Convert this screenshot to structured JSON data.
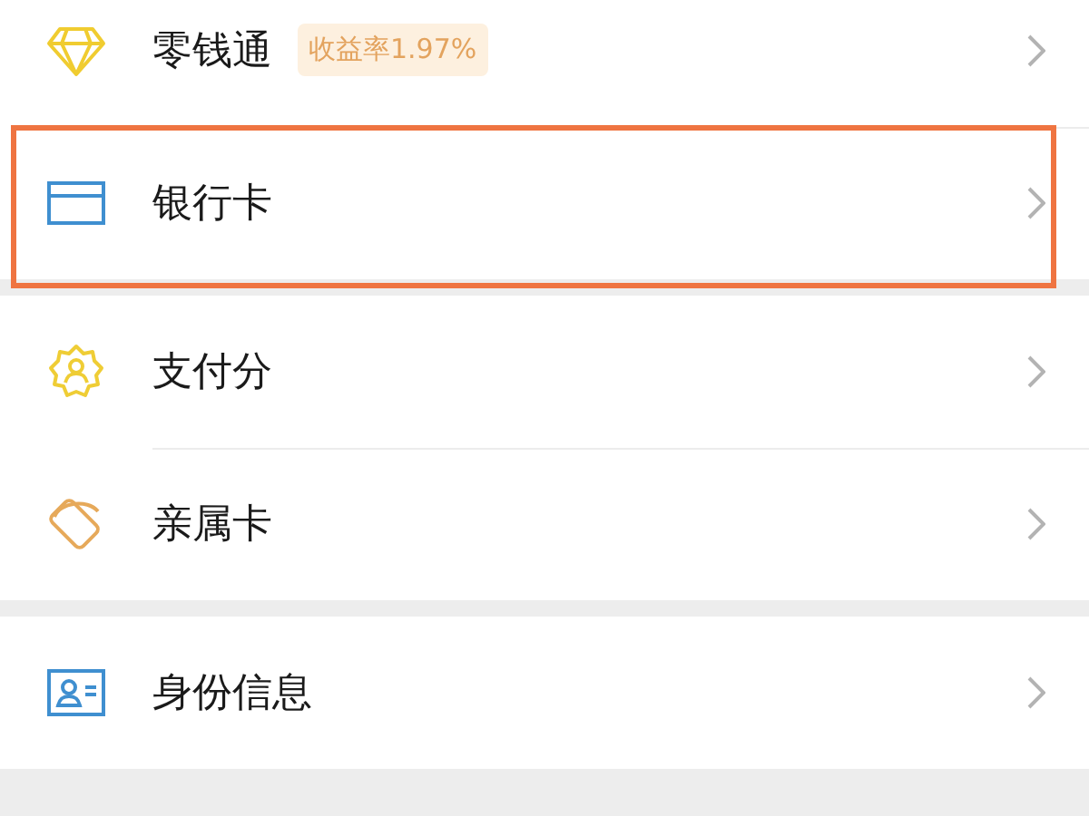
{
  "sections": [
    {
      "items": [
        {
          "label": "零钱通",
          "badge": "收益率1.97%",
          "highlighted": false
        },
        {
          "label": "银行卡",
          "highlighted": true
        }
      ]
    },
    {
      "items": [
        {
          "label": "支付分",
          "highlighted": false
        },
        {
          "label": "亲属卡",
          "highlighted": false
        }
      ]
    },
    {
      "items": [
        {
          "label": "身份信息",
          "highlighted": false
        }
      ]
    }
  ]
}
